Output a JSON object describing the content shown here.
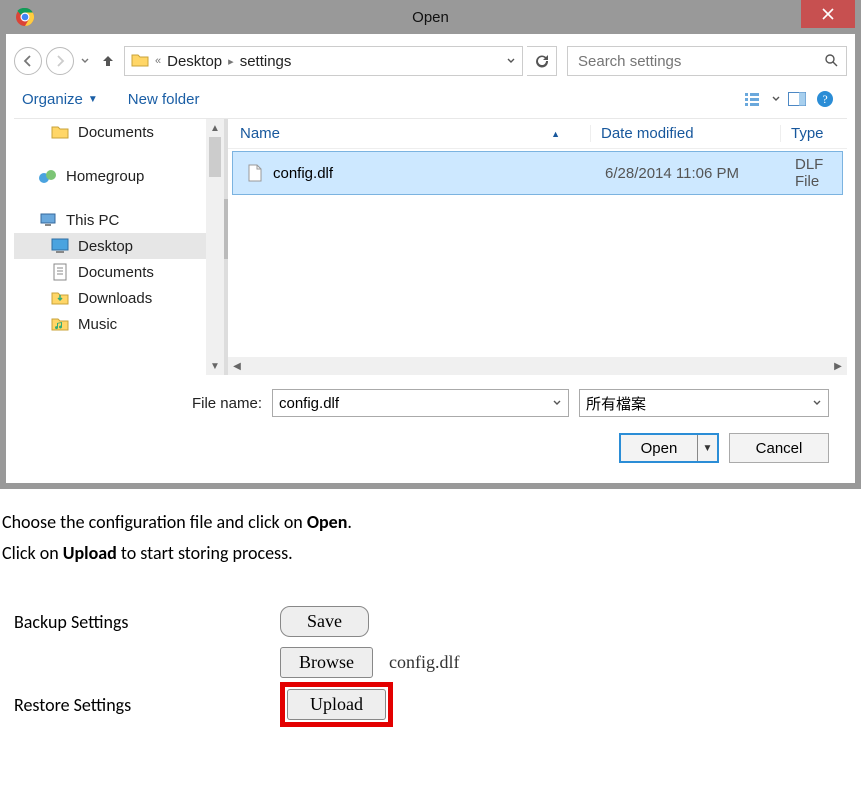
{
  "dialog": {
    "title": "Open",
    "breadcrumb": {
      "ellipsis": "«",
      "part1": "Desktop",
      "part2": "settings"
    },
    "search_placeholder": "Search settings",
    "toolbar": {
      "organize": "Organize",
      "new_folder": "New folder"
    },
    "sidebar": {
      "documents": "Documents",
      "homegroup": "Homegroup",
      "this_pc": "This PC",
      "desktop": "Desktop",
      "documents2": "Documents",
      "downloads": "Downloads",
      "music": "Music"
    },
    "columns": {
      "name": "Name",
      "date": "Date modified",
      "type": "Type"
    },
    "file": {
      "name": "config.dlf",
      "date": "6/28/2014 11:06 PM",
      "type": "DLF File"
    },
    "footer": {
      "filename_label": "File name:",
      "filename_value": "config.dlf",
      "filetype_value": "所有檔案",
      "open": "Open",
      "cancel": "Cancel"
    }
  },
  "instructions": {
    "line1_a": "Choose the configuration file and click on ",
    "line1_b": "Open",
    "line1_c": ".",
    "line2_a": "Click on ",
    "line2_b": "Upload",
    "line2_c": " to start storing process."
  },
  "form": {
    "backup_label": "Backup Settings",
    "save": "Save",
    "restore_label": "Restore Settings",
    "browse": "Browse",
    "filename": "config.dlf",
    "upload": "Upload"
  }
}
